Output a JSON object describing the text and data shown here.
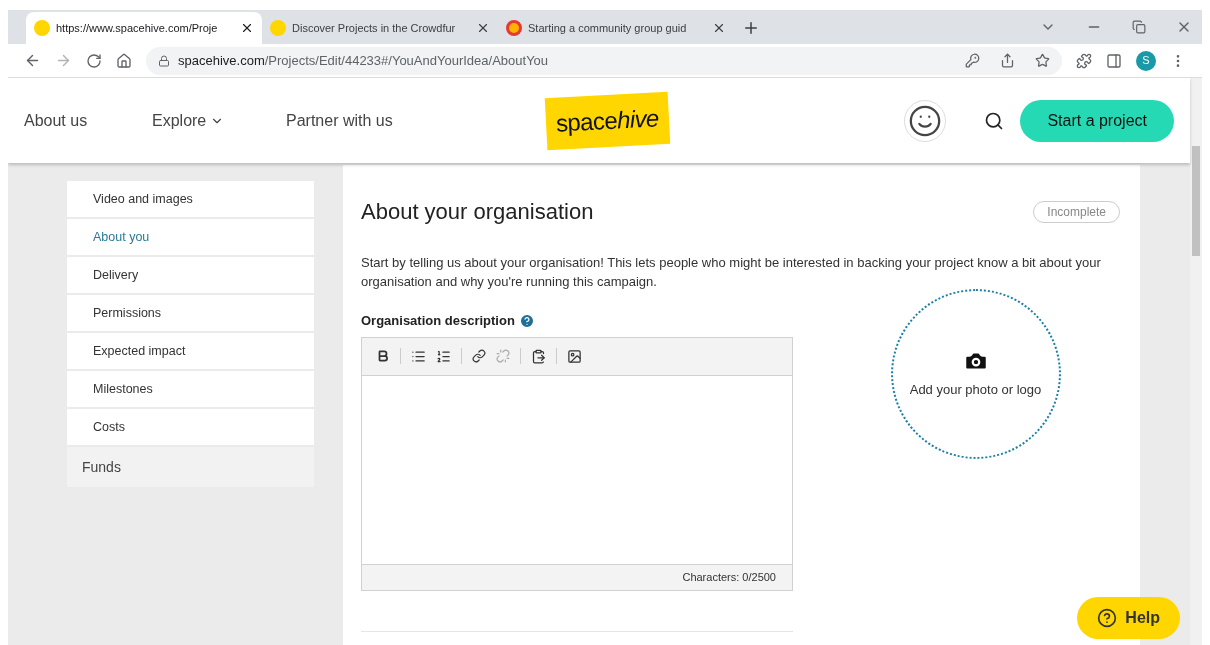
{
  "browser": {
    "tabs": [
      {
        "title": "https://www.spacehive.com/Proje",
        "selected": true
      },
      {
        "title": "Discover Projects in the Crowdfur",
        "selected": false
      },
      {
        "title": "Starting a community group guid",
        "selected": false
      }
    ],
    "address_host": "spacehive.com",
    "address_path": "/Projects/Edit/44233#/YouAndYourIdea/AboutYou",
    "profile": "S"
  },
  "header": {
    "nav": [
      "About us",
      "Explore",
      "Partner with us"
    ],
    "logo": {
      "plain": "space",
      "italic": "hive"
    },
    "cta": "Start a project"
  },
  "sidebar": {
    "items": [
      {
        "label": "Video and images",
        "kind": "step",
        "selected": false
      },
      {
        "label": "About you",
        "kind": "step",
        "selected": true
      },
      {
        "label": "Delivery",
        "kind": "step",
        "selected": false
      },
      {
        "label": "Permissions",
        "kind": "step",
        "selected": false
      },
      {
        "label": "Expected impact",
        "kind": "step",
        "selected": false
      },
      {
        "label": "Milestones",
        "kind": "step",
        "selected": false
      },
      {
        "label": "Costs",
        "kind": "step",
        "selected": false
      },
      {
        "label": "Funds",
        "kind": "section",
        "selected": false
      }
    ]
  },
  "section": {
    "title": "About your organisation",
    "status": "Incomplete",
    "intro": "Start by telling us about your organisation! This lets people who might be interested in backing your project know a bit about your organisation and why you're running this campaign.",
    "field_label": "Organisation description",
    "char_count": "Characters: 0/2500",
    "photo_label": "Add your photo or logo"
  },
  "help": "Help"
}
